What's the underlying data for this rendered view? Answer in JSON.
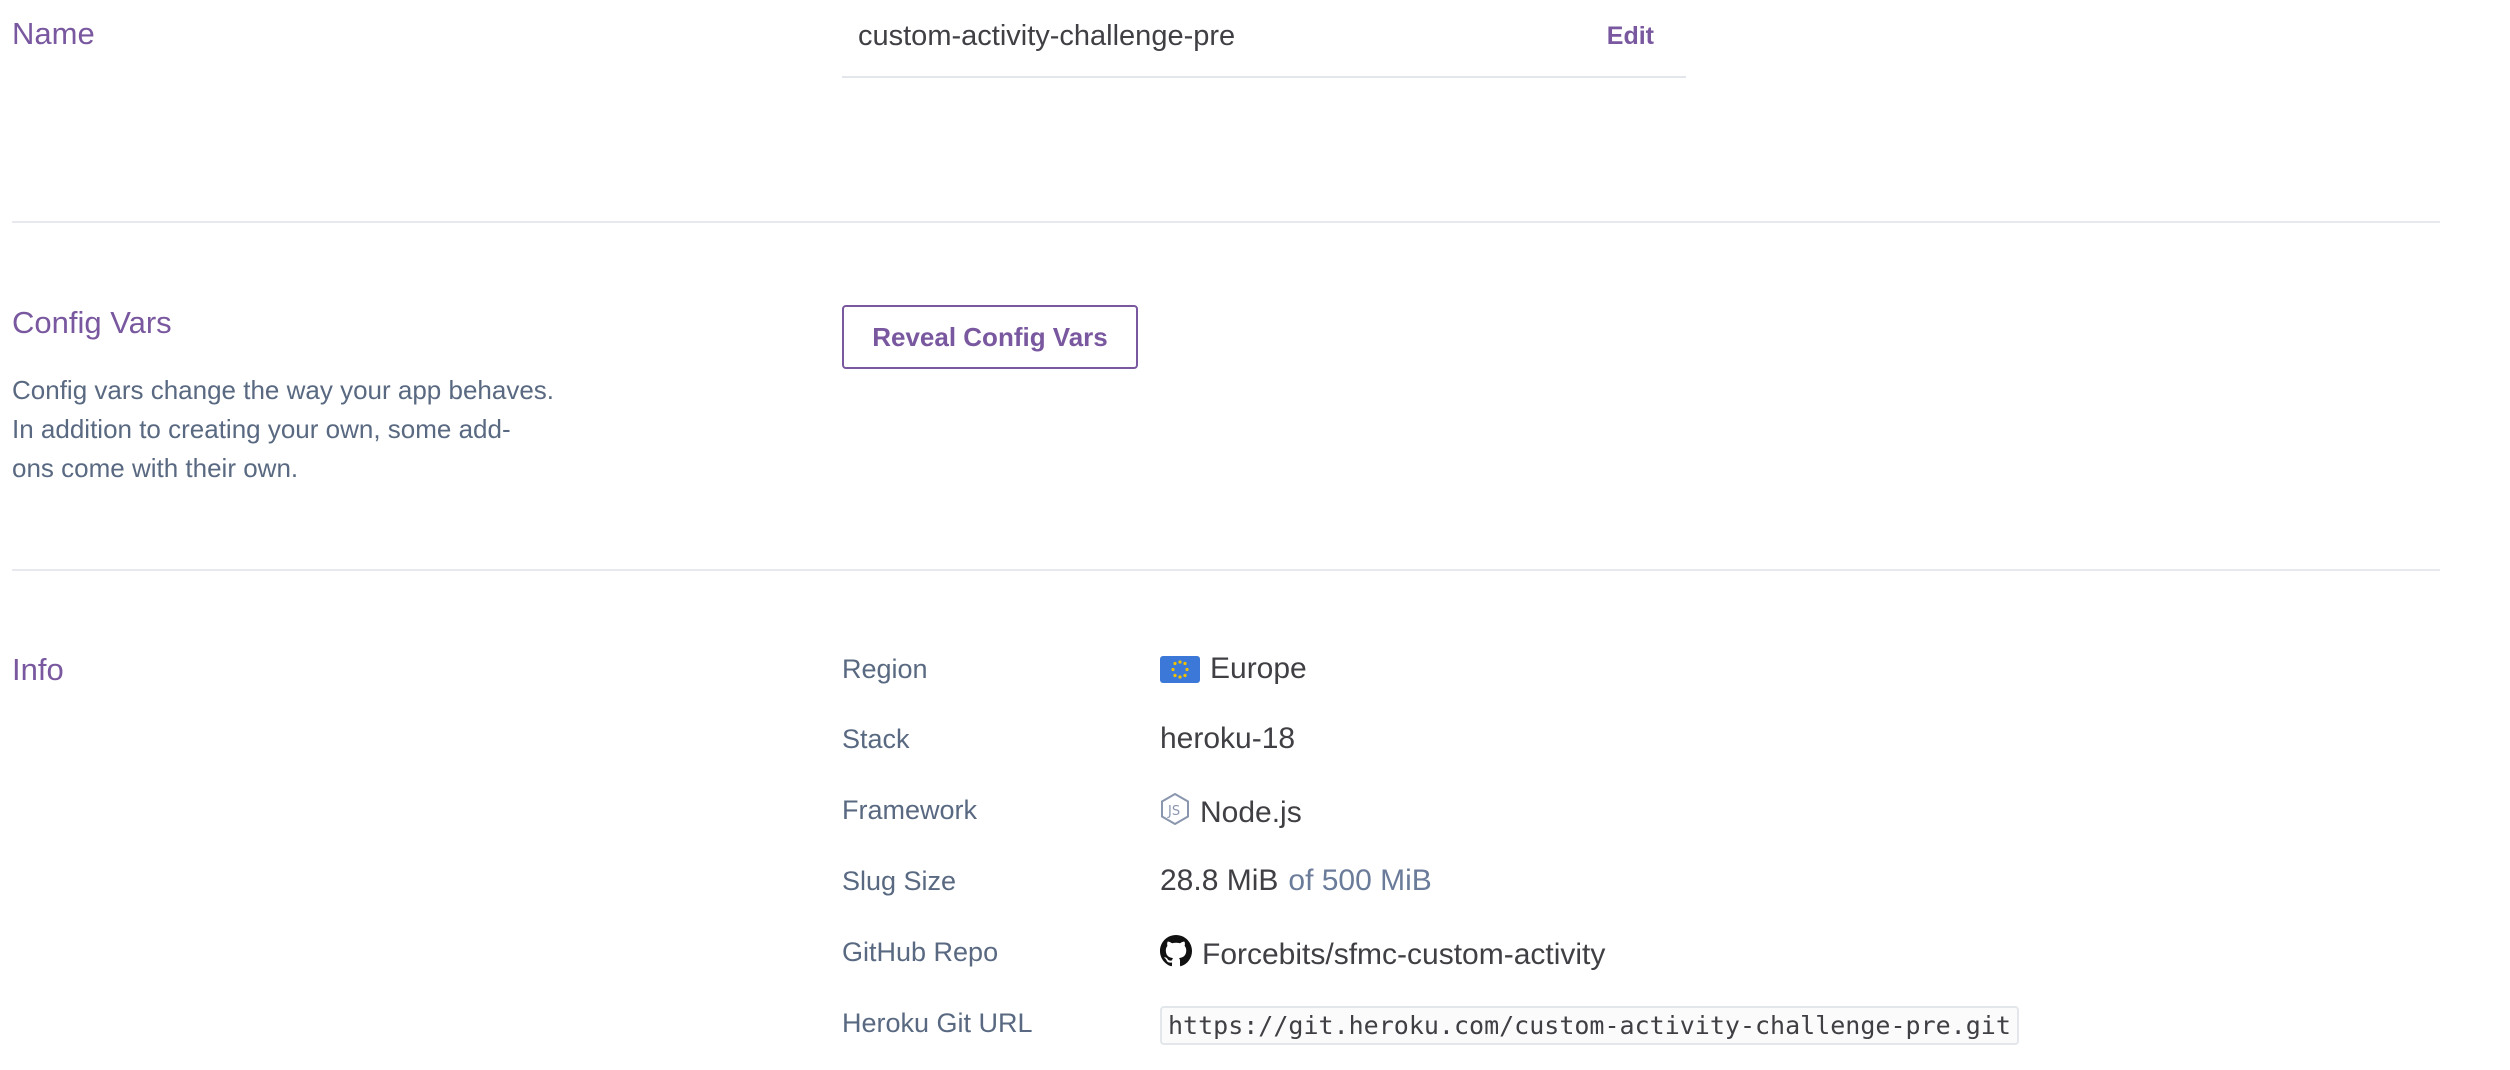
{
  "name_section": {
    "title": "Name",
    "value": "custom-activity-challenge-pre",
    "edit_label": "Edit"
  },
  "config_section": {
    "title": "Config Vars",
    "description_lines": [
      "Config vars change the way your app behaves.",
      "In addition to creating your own, some add-",
      "ons come with their own."
    ],
    "button_label": "Reveal Config Vars"
  },
  "info_section": {
    "title": "Info",
    "rows": [
      {
        "label": "Region",
        "value": "Europe",
        "icon": "eu-flag-icon"
      },
      {
        "label": "Stack",
        "value": "heroku-18"
      },
      {
        "label": "Framework",
        "value": "Node.js",
        "icon": "nodejs-icon"
      },
      {
        "label": "Slug Size",
        "value": "28.8 MiB",
        "suffix": "of 500 MiB"
      },
      {
        "label": "GitHub Repo",
        "value": "Forcebits/sfmc-custom-activity",
        "icon": "github-icon"
      },
      {
        "label": "Heroku Git URL",
        "value": "https://git.heroku.com/custom-activity-challenge-pre.git"
      }
    ]
  },
  "colors": {
    "accent": "#79589f",
    "muted_text": "#596981",
    "divider": "#e8e9ee"
  }
}
